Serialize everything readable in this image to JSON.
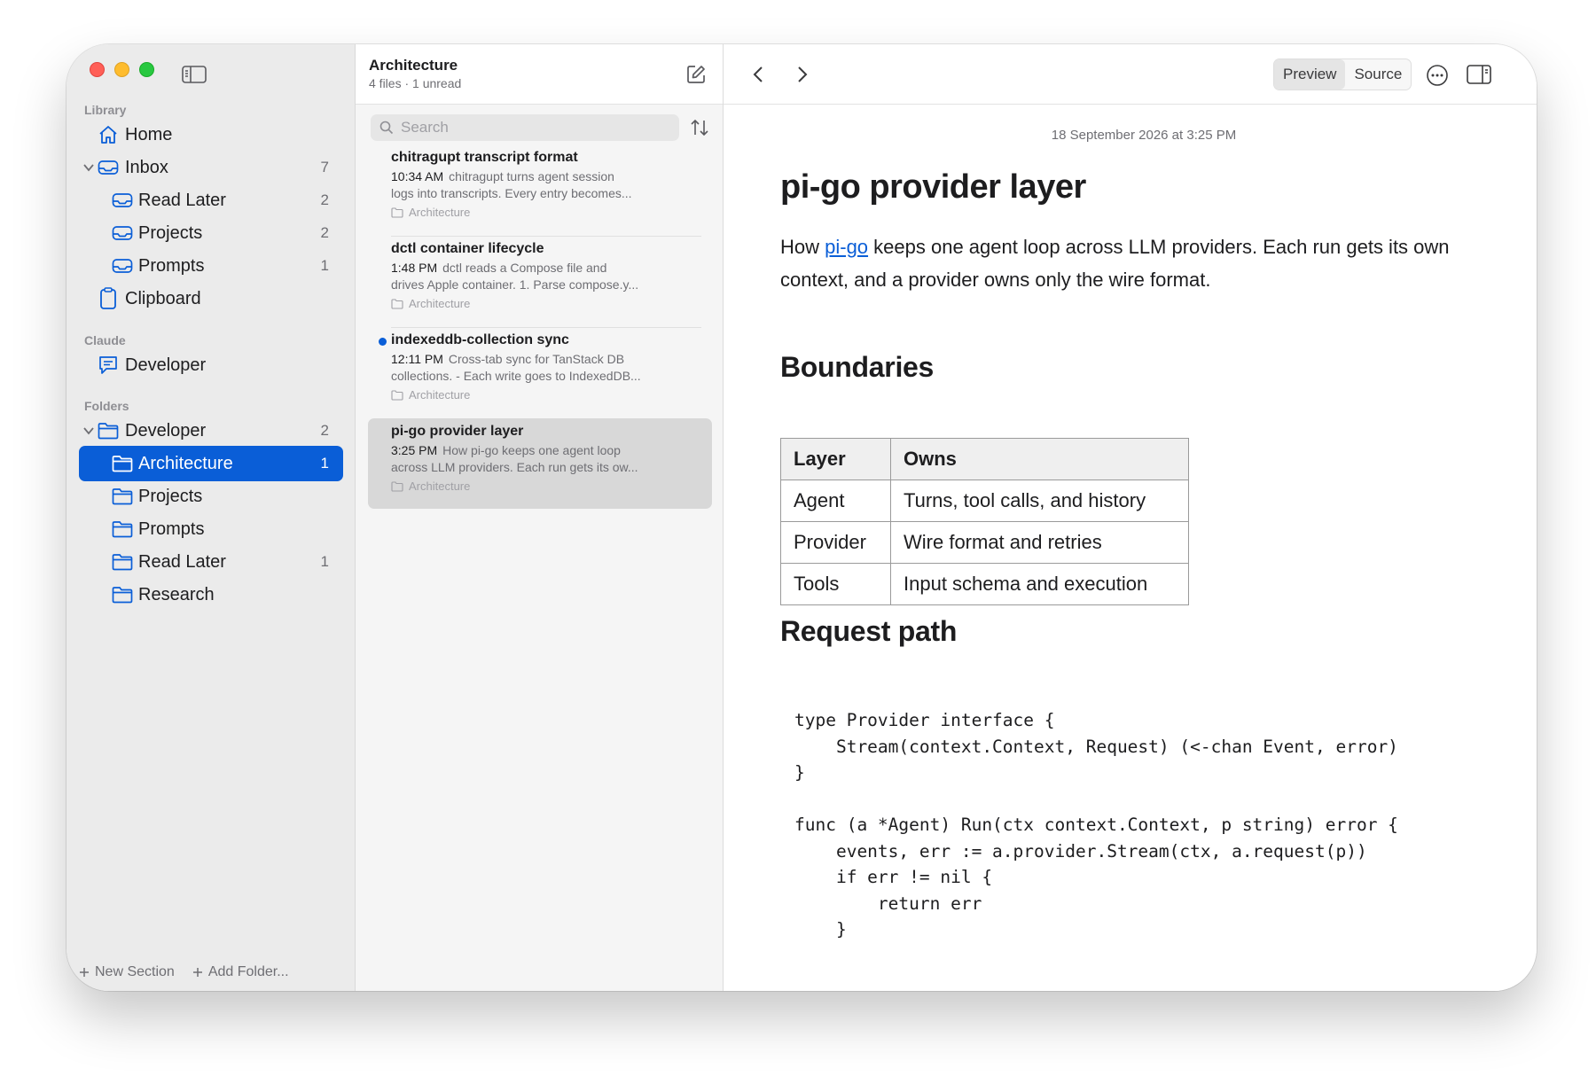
{
  "sidebar": {
    "sections": {
      "library": "Library",
      "claude": "Claude",
      "folders": "Folders"
    },
    "library_items": [
      {
        "label": "Home",
        "count": ""
      },
      {
        "label": "Inbox",
        "count": "7"
      },
      {
        "label": "Read Later",
        "count": "2"
      },
      {
        "label": "Projects",
        "count": "2"
      },
      {
        "label": "Prompts",
        "count": "1"
      },
      {
        "label": "Clipboard",
        "count": ""
      }
    ],
    "claude_items": [
      {
        "label": "Developer",
        "count": ""
      }
    ],
    "folder_items": [
      {
        "label": "Developer",
        "count": "2"
      },
      {
        "label": "Architecture",
        "count": "1"
      },
      {
        "label": "Projects",
        "count": ""
      },
      {
        "label": "Prompts",
        "count": ""
      },
      {
        "label": "Read Later",
        "count": "1"
      },
      {
        "label": "Research",
        "count": ""
      }
    ],
    "footer": {
      "new_section": "New Section",
      "add_folder": "Add Folder..."
    }
  },
  "list": {
    "title": "Architecture",
    "subtitle": "4 files · 1 unread",
    "search_placeholder": "Search",
    "notes": [
      {
        "title": "chitragupt transcript format",
        "time": "10:34 AM",
        "preview1": "chitragupt turns agent session",
        "preview2": "logs into transcripts. Every entry becomes...",
        "folder": "Architecture",
        "unread": false
      },
      {
        "title": "dctl container lifecycle",
        "time": "1:48 PM",
        "preview1": "dctl reads a Compose file and",
        "preview2": "drives Apple container. 1. Parse compose.y...",
        "folder": "Architecture",
        "unread": false
      },
      {
        "title": "indexeddb-collection sync",
        "time": "12:11 PM",
        "preview1": "Cross-tab sync for TanStack DB",
        "preview2": "collections. - Each write goes to IndexedDB...",
        "folder": "Architecture",
        "unread": true
      },
      {
        "title": "pi-go provider layer",
        "time": "3:25 PM",
        "preview1": "How pi-go keeps one agent loop",
        "preview2": "across LLM providers. Each run gets its ow...",
        "folder": "Architecture",
        "unread": false
      }
    ]
  },
  "toolbar": {
    "preview_label": "Preview",
    "source_label": "Source"
  },
  "document": {
    "date": "18 September 2026 at 3:25 PM",
    "title": "pi-go provider layer",
    "intro_before": "How ",
    "intro_link": "pi-go",
    "intro_after": " keeps one agent loop across LLM providers. Each run gets its own context, and a provider owns only the wire format.",
    "h_boundaries": "Boundaries",
    "table": {
      "headers": [
        "Layer",
        "Owns"
      ],
      "rows": [
        [
          "Agent",
          "Turns, tool calls, and history"
        ],
        [
          "Provider",
          "Wire format and retries"
        ],
        [
          "Tools",
          "Input schema and execution"
        ]
      ]
    },
    "h_request": "Request path",
    "code": "type Provider interface {\n    Stream(context.Context, Request) (<-chan Event, error)\n}\n\nfunc (a *Agent) Run(ctx context.Context, p string) error {\n    events, err := a.provider.Stream(ctx, a.request(p))\n    if err != nil {\n        return err\n    }"
  },
  "colors": {
    "accent": "#0a5ed7",
    "sidebar_bg": "#ebebeb",
    "list_bg": "#f5f5f5"
  }
}
